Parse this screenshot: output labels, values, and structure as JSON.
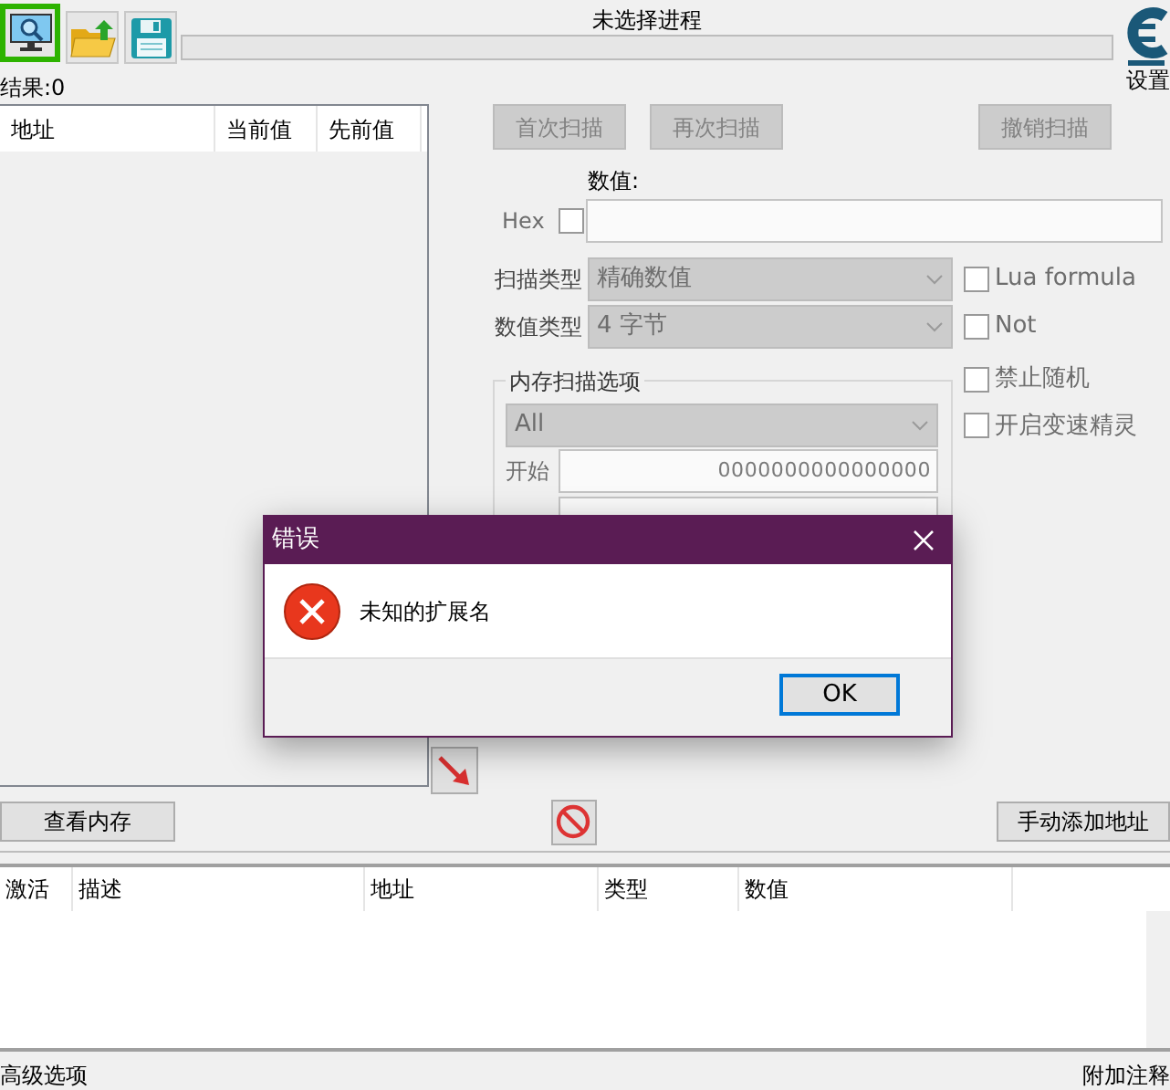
{
  "toolbar": [
    {
      "kind": "process",
      "selected": true
    },
    {
      "kind": "open",
      "selected": false
    },
    {
      "kind": "save",
      "selected": false
    }
  ],
  "process_title": "未选择进程",
  "progress": {
    "level": 0
  },
  "settings_label": "设置",
  "results": "结果:0",
  "found_list": {
    "columns": [
      "地址",
      "当前值",
      "先前值"
    ]
  },
  "scan_buttons": [
    {
      "label": "首次扫描",
      "disabled": true
    },
    {
      "label": "再次扫描",
      "disabled": true
    },
    {
      "label": "撤销扫描",
      "disabled": true
    }
  ],
  "value": {
    "label": "数值:",
    "hex_label": "Hex",
    "hex_checked": false
  },
  "scan_type": {
    "label": "扫描类型",
    "value": "精确数值"
  },
  "value_type": {
    "label": "数值类型",
    "value": "4 字节"
  },
  "options": [
    {
      "label": "Lua formula",
      "checked": false
    },
    {
      "label": "Not",
      "checked": false
    }
  ],
  "memory_options": {
    "title": "内存扫描选项",
    "region": "All",
    "start_label": "开始",
    "start": "0000000000000000"
  },
  "extra_options": [
    {
      "label": "禁止随机",
      "checked": false
    },
    {
      "label": "开启变速精灵",
      "checked": false
    }
  ],
  "memory_view_button": "查看内存",
  "add_address_button": "手动添加地址",
  "cheat_table": {
    "columns": [
      "激活",
      "描述",
      "地址",
      "类型",
      "数值"
    ]
  },
  "status_bar": {
    "left": "高级选项",
    "right": "附加注释"
  },
  "dialog": {
    "title": "错误",
    "message": "未知的扩展名",
    "button": "OK"
  }
}
